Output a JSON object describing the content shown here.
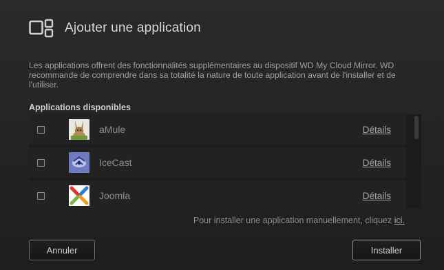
{
  "dialog": {
    "title": "Ajouter une application",
    "description": "Les applications offrent des fonctionnalités supplémentaires au dispositif WD My Cloud Mirror. WD recommande de comprendre dans sa totalité la nature de toute application avant de l'installer et de l'utiliser.",
    "section_title": "Applications disponibles"
  },
  "apps": [
    {
      "name": "aMule",
      "details_label": "Détails",
      "checked": false,
      "icon": "amule-icon"
    },
    {
      "name": "IceCast",
      "details_label": "Détails",
      "checked": false,
      "icon": "icecast-icon"
    },
    {
      "name": "Joomla",
      "details_label": "Détails",
      "checked": false,
      "icon": "joomla-icon"
    }
  ],
  "manual_install": {
    "text": "Pour installer une application manuellement, cliquez ",
    "link_label": "ici."
  },
  "buttons": {
    "cancel_label": "Annuler",
    "install_label": "Installer"
  },
  "colors": {
    "background": "#1f1f1f",
    "joomla_red": "#e0352c",
    "joomla_green": "#7cb342",
    "joomla_blue": "#2d7dd2",
    "joomla_orange": "#f39c1e"
  }
}
